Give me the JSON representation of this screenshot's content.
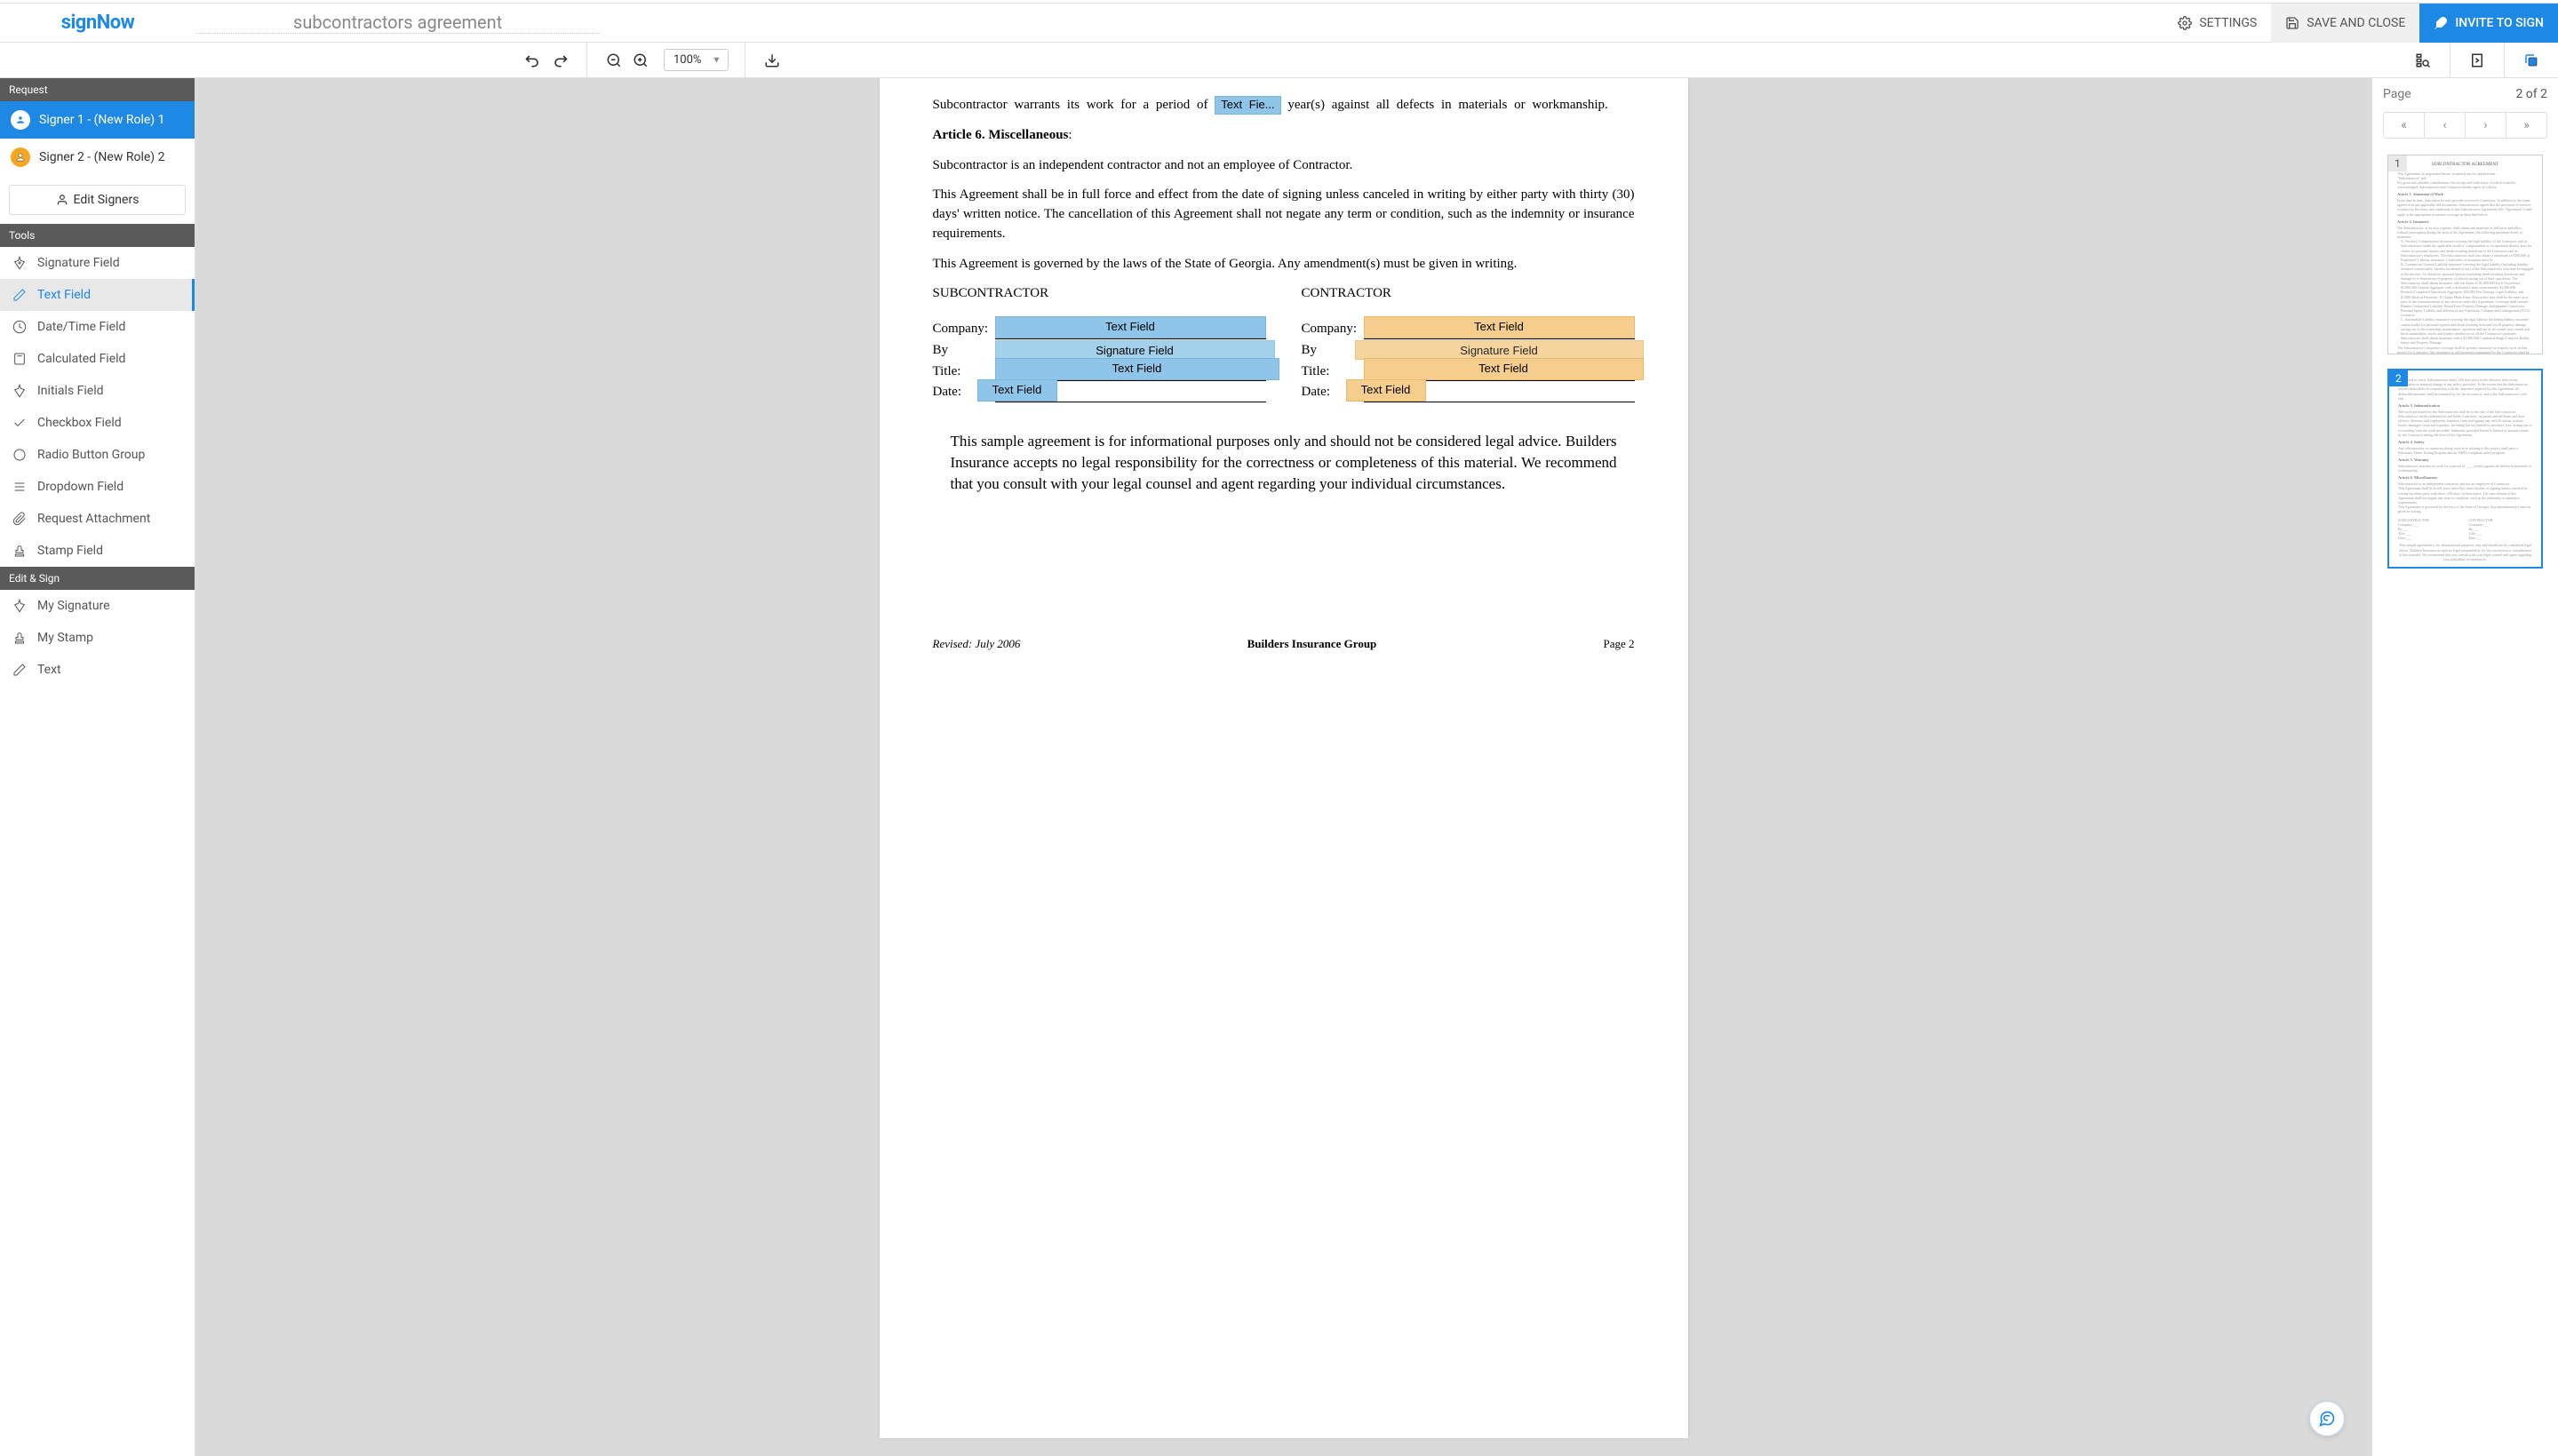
{
  "logo": "signNow",
  "doc_title": "subcontractors agreement",
  "header": {
    "settings": "SETTINGS",
    "save": "SAVE AND CLOSE",
    "invite": "INVITE TO SIGN"
  },
  "zoom": "100%",
  "sidebar": {
    "request_hdr": "Request",
    "signers": [
      {
        "label": "Signer 1 - (New Role) 1"
      },
      {
        "label": "Signer 2 - (New Role) 2"
      }
    ],
    "edit_signers": "Edit Signers",
    "tools_hdr": "Tools",
    "tools": [
      "Signature Field",
      "Text Field",
      "Date/Time Field",
      "Calculated Field",
      "Initials Field",
      "Checkbox Field",
      "Radio Button Group",
      "Dropdown Field",
      "Request Attachment",
      "Stamp Field"
    ],
    "editsign_hdr": "Edit & Sign",
    "editsign": [
      "My Signature",
      "My Stamp",
      "Text"
    ]
  },
  "doc": {
    "warranty_pre": "Subcontractor warrants its work for a period of ",
    "warranty_field": "Text Fie...",
    "warranty_post": " year(s) against all defects in materials or workmanship.",
    "art6_hdr": "Article 6.  Miscellaneous",
    "indep": "Subcontractor is an independent contractor and not an employee of Contractor.",
    "force": "This Agreement shall be in full force and effect from the date of signing unless canceled in writing by either party with thirty (30) days' written notice.  The cancellation of this Agreement shall not negate any term or condition, such as the indemnity or insurance requirements.",
    "governed": "This Agreement is governed by the laws of the State of Georgia.  Any amendment(s) must be given in writing.",
    "sub_hdr": "SUBCONTRACTOR",
    "con_hdr": "CONTRACTOR",
    "company": "Company:",
    "by": "By",
    "title": "Title:",
    "date": "Date:",
    "text_field": "Text Field",
    "sig_field": "Signature Field",
    "disclaimer": "This sample agreement is for informational purposes only and should not be considered legal advice.  Builders Insurance accepts no legal responsibility for the correctness or completeness of this material.  We recommend that you consult with your legal counsel and agent regarding your individual circumstances.",
    "revised": "Revised: July 2006",
    "company_footer": "Builders Insurance Group",
    "page_footer": "Page 2"
  },
  "thumbs": {
    "page_label": "Page",
    "page_count": "2 of 2",
    "p1": "1",
    "p2": "2"
  }
}
